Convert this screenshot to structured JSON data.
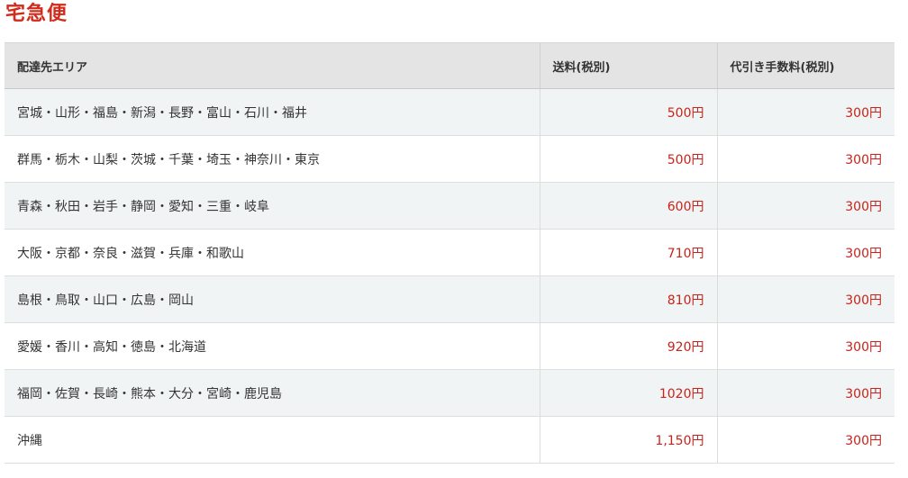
{
  "title": "宅急便",
  "table": {
    "headers": [
      "配達先エリア",
      "送料(税別)",
      "代引き手数料(税別)"
    ],
    "rows": [
      {
        "area": "宮城・山形・福島・新潟・長野・富山・石川・福井",
        "shipping": "500円",
        "cod_fee": "300円"
      },
      {
        "area": "群馬・栃木・山梨・茨城・千葉・埼玉・神奈川・東京",
        "shipping": "500円",
        "cod_fee": "300円"
      },
      {
        "area": "青森・秋田・岩手・静岡・愛知・三重・岐阜",
        "shipping": "600円",
        "cod_fee": "300円"
      },
      {
        "area": "大阪・京都・奈良・滋賀・兵庫・和歌山",
        "shipping": "710円",
        "cod_fee": "300円"
      },
      {
        "area": "島根・鳥取・山口・広島・岡山",
        "shipping": "810円",
        "cod_fee": "300円"
      },
      {
        "area": "愛媛・香川・高知・徳島・北海道",
        "shipping": "920円",
        "cod_fee": "300円"
      },
      {
        "area": "福岡・佐賀・長崎・熊本・大分・宮崎・鹿児島",
        "shipping": "1020円",
        "cod_fee": "300円"
      },
      {
        "area": "沖縄",
        "shipping": "1,150円",
        "cod_fee": "300円"
      }
    ]
  },
  "colors": {
    "title": "#d22b1b",
    "price": "#c8231b",
    "header_bg": "#e4e4e4",
    "row_alt_bg": "#f1f4f4"
  }
}
